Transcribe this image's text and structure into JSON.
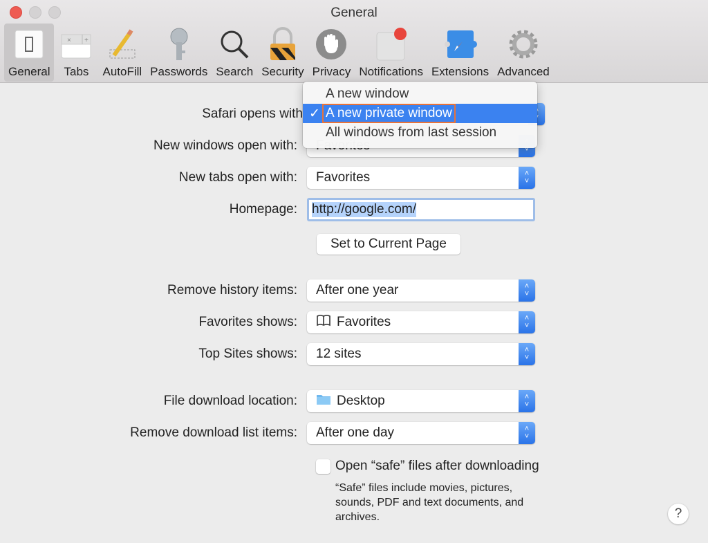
{
  "window": {
    "title": "General"
  },
  "toolbar": [
    {
      "label": "General",
      "icon": "general-switch-icon"
    },
    {
      "label": "Tabs",
      "icon": "tabs-icon"
    },
    {
      "label": "AutoFill",
      "icon": "pencil-icon"
    },
    {
      "label": "Passwords",
      "icon": "key-icon"
    },
    {
      "label": "Search",
      "icon": "magnifier-icon"
    },
    {
      "label": "Security",
      "icon": "padlock-icon"
    },
    {
      "label": "Privacy",
      "icon": "hand-icon"
    },
    {
      "label": "Notifications",
      "icon": "notification-badge-icon"
    },
    {
      "label": "Extensions",
      "icon": "puzzle-compass-icon"
    },
    {
      "label": "Advanced",
      "icon": "gear-icon"
    }
  ],
  "form": {
    "safari_opens_with": {
      "label": "Safari opens with",
      "value": "A new private window"
    },
    "new_windows_open_with": {
      "label": "New windows open with:",
      "value": "Favorites"
    },
    "new_tabs_open_with": {
      "label": "New tabs open with:",
      "value": "Favorites"
    },
    "homepage": {
      "label": "Homepage:",
      "value": "http://google.com/"
    },
    "set_current_page": "Set to Current Page",
    "remove_history": {
      "label": "Remove history items:",
      "value": "After one year"
    },
    "favorites_shows": {
      "label": "Favorites shows:",
      "value": "Favorites"
    },
    "top_sites_shows": {
      "label": "Top Sites shows:",
      "value": "12 sites"
    },
    "download_location": {
      "label": "File download location:",
      "value": "Desktop"
    },
    "remove_download": {
      "label": "Remove download list items:",
      "value": "After one day"
    },
    "open_safe": {
      "label": "Open “safe” files after downloading",
      "checked": false,
      "note_lines": [
        "“Safe” files include movies, pictures,",
        "sounds, PDF and text documents, and",
        "archives."
      ]
    },
    "help": "?"
  },
  "menu": {
    "items": [
      {
        "label": "A new window",
        "selected": false
      },
      {
        "label": "A new private window",
        "selected": true
      },
      {
        "label": "All windows from last session",
        "selected": false
      }
    ],
    "checkmark": "✓"
  },
  "stepper_glyphs": {
    "up": "˄",
    "down": "˅"
  }
}
